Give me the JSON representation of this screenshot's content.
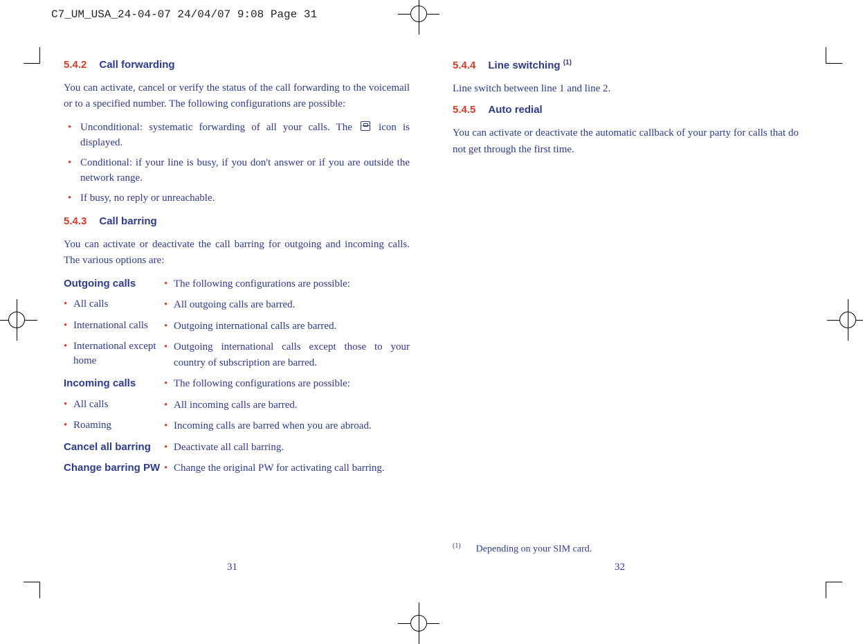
{
  "print_header": "C7_UM_USA_24-04-07  24/04/07  9:08  Page 31",
  "left": {
    "s542": {
      "num": "5.4.2",
      "title": "Call forwarding"
    },
    "p542": "You can activate, cancel or verify the status of the call forwarding to the voicemail or to a specified number. The following configurations are possible:",
    "b542": {
      "i0a": "Unconditional: systematic forwarding of all your calls. The ",
      "i0b": " icon is displayed.",
      "i1": "Conditional: if your line is busy, if you don't answer or if you are outside the network range.",
      "i2": "If busy, no reply or unreachable."
    },
    "s543": {
      "num": "5.4.3",
      "title": "Call barring"
    },
    "p543": "You can activate or deactivate the call barring for outgoing and incoming calls. The various options are:",
    "tbl": [
      {
        "term": "Outgoing calls",
        "bold": true,
        "desc": "The following configurations are possible:"
      },
      {
        "term": "All calls",
        "bold": false,
        "desc": "All outgoing calls are barred."
      },
      {
        "term": "International calls",
        "bold": false,
        "desc": "Outgoing international calls are barred."
      },
      {
        "term": "International except home",
        "bold": false,
        "desc": "Outgoing international calls except those to your country of subscription are barred."
      },
      {
        "term": "Incoming calls",
        "bold": true,
        "desc": "The following configurations are possible:"
      },
      {
        "term": "All calls",
        "bold": false,
        "desc": "All incoming calls are barred."
      },
      {
        "term": "Roaming",
        "bold": false,
        "desc": "Incoming calls are barred when you are abroad."
      },
      {
        "term": "Cancel all barring",
        "bold": true,
        "desc": "Deactivate all call barring."
      },
      {
        "term": "Change barring PW",
        "bold": true,
        "desc": "Change the original PW for activating call barring."
      }
    ]
  },
  "right": {
    "s544": {
      "num": "5.4.4",
      "title": "Line switching ",
      "sup": "(1)"
    },
    "p544": "Line switch between line 1 and line 2.",
    "s545": {
      "num": "5.4.5",
      "title": "Auto redial"
    },
    "p545": "You can activate or deactivate the automatic callback of your party for calls that do not get through the first time."
  },
  "footnote": {
    "mark": "(1)",
    "text": "Depending on your SIM card."
  },
  "pagenums": {
    "left": "31",
    "right": "32"
  }
}
